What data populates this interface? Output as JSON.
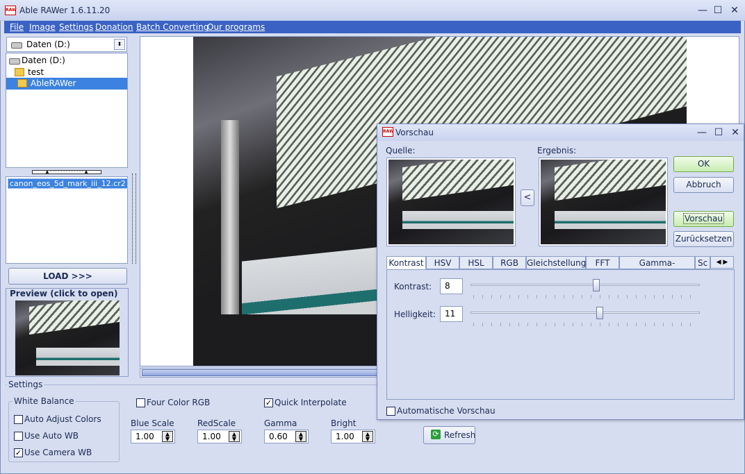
{
  "app": {
    "title": "Able RAWer 1.6.11.20",
    "icon_text": "RAW"
  },
  "window_controls": {
    "minimize": "—",
    "maximize": "☐",
    "close": "✕"
  },
  "menu": [
    "File",
    "Image",
    "Settings",
    "Donation",
    "Batch Converting",
    "Our programs"
  ],
  "drive_combo": {
    "value": "Daten (D:)"
  },
  "tree": [
    {
      "label": "Daten (D:)",
      "type": "drive"
    },
    {
      "label": "test",
      "type": "folder"
    },
    {
      "label": "AbleRAWer",
      "type": "folder",
      "selected": true
    }
  ],
  "files": [
    "canon_eos_5d_mark_iii_12.cr2"
  ],
  "load_button": "LOAD >>>",
  "preview_label": "Preview (click to open)",
  "settings": {
    "label": "Settings",
    "white_balance": "White Balance",
    "auto_adjust": "Auto Adjust Colors",
    "use_auto_wb": "Use Auto WB",
    "use_camera_wb": "Use Camera WB",
    "four_color": "Four Color RGB",
    "quick_interp": "Quick Interpolate",
    "blue_scale": {
      "label": "Blue Scale",
      "value": "1.00"
    },
    "red_scale": {
      "label": "RedScale",
      "value": "1.00"
    },
    "gamma": {
      "label": "Gamma",
      "value": "0.60"
    },
    "bright": {
      "label": "Bright",
      "value": "1.00"
    },
    "refresh": "Refresh"
  },
  "dialog": {
    "title": "Vorschau",
    "source_label": "Quelle:",
    "result_label": "Ergebnis:",
    "copy_button": "<",
    "ok": "OK",
    "cancel": "Abbruch",
    "preview": "Vorschau",
    "reset": "Zurücksetzen",
    "tabs": [
      "Kontrast",
      "HSV",
      "HSL",
      "RGB",
      "Gleichstellung",
      "FFT",
      "Gamma-Korrektur",
      "Sc"
    ],
    "contrast": {
      "label": "Kontrast:",
      "value": "8",
      "fraction": 0.54
    },
    "brightness": {
      "label": "Helligkeit:",
      "value": "11",
      "fraction": 0.555
    },
    "auto_preview": "Automatische Vorschau"
  }
}
